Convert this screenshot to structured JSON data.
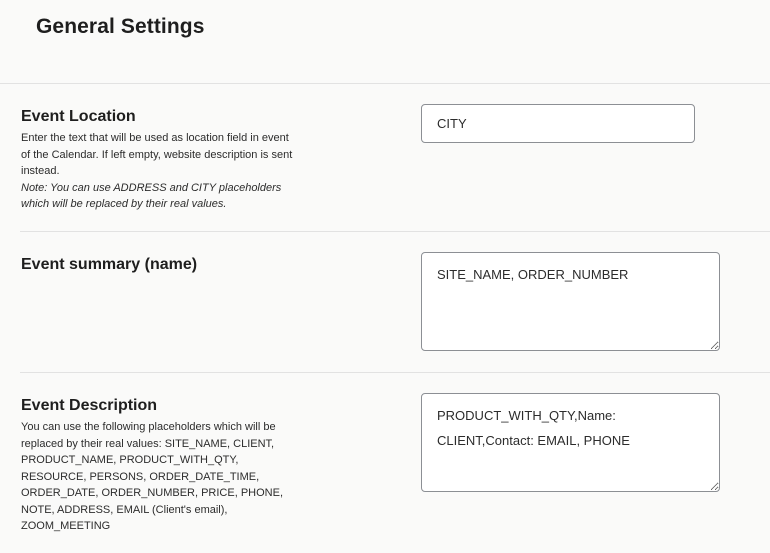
{
  "page": {
    "title": "General Settings"
  },
  "event_location": {
    "label": "Event Location",
    "help": "Enter the text that will be used as location field in event of the Calendar. If left empty, website description is sent instead.",
    "note": "Note: You can use ADDRESS and CITY placeholders which will be replaced by their real values.",
    "value": "CITY"
  },
  "event_summary": {
    "label": "Event summary (name)",
    "value": "SITE_NAME, ORDER_NUMBER"
  },
  "event_description": {
    "label": "Event Description",
    "help": "You can use the following placeholders which will be replaced by their real values: SITE_NAME, CLIENT, PRODUCT_NAME, PRODUCT_WITH_QTY, RESOURCE, PERSONS, ORDER_DATE_TIME, ORDER_DATE, ORDER_NUMBER, PRICE, PHONE, NOTE, ADDRESS, EMAIL (Client's email), ZOOM_MEETING",
    "value": "PRODUCT_WITH_QTY,Name: CLIENT,Contact: EMAIL, PHONE"
  }
}
